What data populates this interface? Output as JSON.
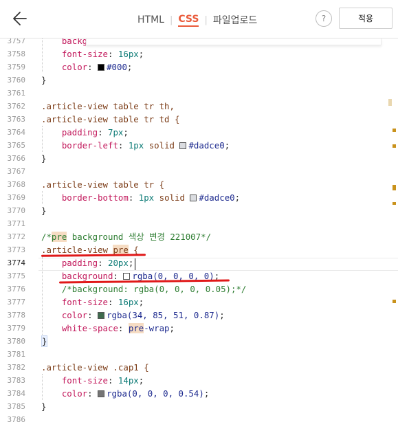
{
  "header": {
    "back_label": "",
    "tabs": [
      {
        "label": "HTML",
        "active": false
      },
      {
        "label": "CSS",
        "active": true
      },
      {
        "label": "파일업로드",
        "active": false
      }
    ],
    "help_label": "?",
    "apply_label": "적용"
  },
  "editor": {
    "current_line": "3774",
    "line_numbers": [
      "3757",
      "3758",
      "3759",
      "3760",
      "3761",
      "3762",
      "3763",
      "3764",
      "3765",
      "3766",
      "3767",
      "3768",
      "3769",
      "3770",
      "3771",
      "3772",
      "3773",
      "3774",
      "3775",
      "3776",
      "3777",
      "3778",
      "3779",
      "3780",
      "3781",
      "3782",
      "3783",
      "3784",
      "3785",
      "3786"
    ],
    "tokens": {
      "l3757_prop": "backgr",
      "l3758_prop": "font-size",
      "l3758_num": "16px",
      "l3759_prop": "color",
      "l3759_val": "#000",
      "l3759_swatch": "#000000",
      "l3760": "}",
      "l3762": ".article-view table tr th,",
      "l3763": ".article-view table tr td {",
      "l3764_prop": "padding",
      "l3764_num": "7px",
      "l3765_prop": "border-left",
      "l3765_num": "1px",
      "l3765_kw": "solid",
      "l3765_val": "#dadce0",
      "l3765_swatch": "#dadce0",
      "l3766": "}",
      "l3768": ".article-view table tr {",
      "l3769_prop": "border-bottom",
      "l3769_num": "1px",
      "l3769_kw": "solid",
      "l3769_val": "#dadce0",
      "l3769_swatch": "#dadce0",
      "l3770": "}",
      "l3772_a": "/*",
      "l3772_pre": "pre",
      "l3772_b": " background 색상 변경 221007*/",
      "l3773_a": ".article-view ",
      "l3773_pre": "pre",
      "l3773_b": " {",
      "l3774_prop": "padding",
      "l3774_num": "20px",
      "l3775_prop": "background",
      "l3775_val": "rgba(0, 0, 0, 0)",
      "l3775_swatch": "rgba(0,0,0,0)",
      "l3776": "/*background: rgba(0, 0, 0, 0.05);*/",
      "l3777_prop": "font-size",
      "l3777_num": "16px",
      "l3778_prop": "color",
      "l3778_val": "rgba(34, 85, 51, 0.87)",
      "l3778_swatch": "rgba(34,85,51,0.87)",
      "l3779_prop": "white-space",
      "l3779_pre": "pre",
      "l3779_val": "-wrap",
      "l3780": "}",
      "l3782": ".article-view .cap1 {",
      "l3783_prop": "font-size",
      "l3783_num": "14px",
      "l3784_prop": "color",
      "l3784_val": "rgba(0, 0, 0, 0.54)",
      "l3784_swatch": "rgba(0,0,0,0.54)",
      "l3785": "}"
    }
  },
  "colors": {
    "accent": "#ea5a3a",
    "annotation_red": "#e01818",
    "scroll_marker": "#c9921c"
  }
}
